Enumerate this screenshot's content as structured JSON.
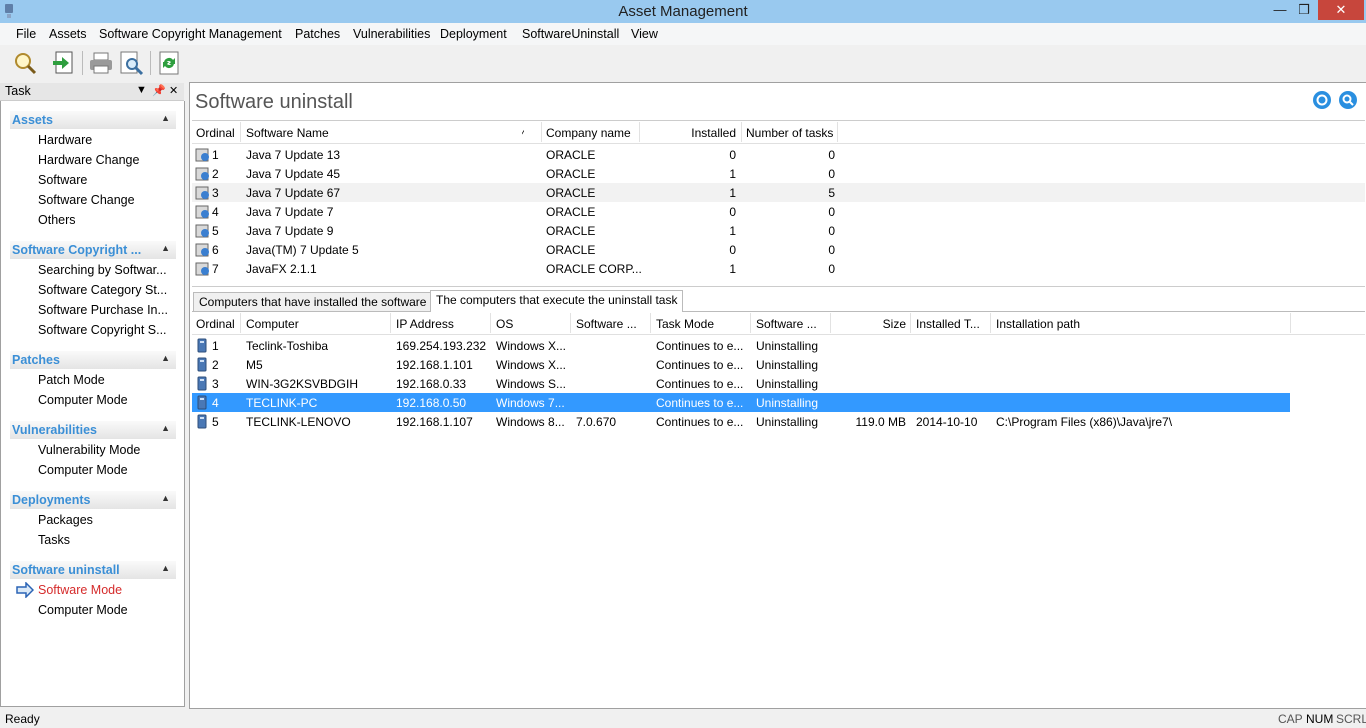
{
  "window": {
    "title": "Asset Management",
    "minimize": "—",
    "maximize": "❒",
    "close": "✕"
  },
  "menu": [
    "File",
    "Assets",
    "Software Copyright Management",
    "Patches",
    "Vulnerabilities",
    "Deployment",
    "SoftwareUninstall",
    "View"
  ],
  "toolbar": [
    "search-icon",
    "export-icon",
    "print-icon",
    "print-preview-icon",
    "refresh-icon"
  ],
  "task_panel": {
    "label": "Task",
    "groups": [
      {
        "title": "Assets",
        "items": [
          "Hardware",
          "Hardware Change",
          "Software",
          "Software Change",
          "Others"
        ]
      },
      {
        "title": "Software Copyright ...",
        "items": [
          "Searching by Softwar...",
          "Software Category St...",
          "Software Purchase In...",
          "Software Copyright S..."
        ]
      },
      {
        "title": "Patches",
        "items": [
          "Patch Mode",
          "Computer Mode"
        ]
      },
      {
        "title": "Vulnerabilities",
        "items": [
          "Vulnerability Mode",
          "Computer Mode"
        ]
      },
      {
        "title": "Deployments",
        "items": [
          "Packages",
          "Tasks"
        ]
      },
      {
        "title": "Software uninstall",
        "items": [
          "Software Mode",
          "Computer Mode"
        ]
      }
    ]
  },
  "main": {
    "heading": "Software uninstall",
    "software_table": {
      "columns": [
        "Ordinal",
        "Software Name",
        "Company name",
        "Installed",
        "Number of tasks"
      ],
      "rows": [
        [
          "1",
          "Java 7 Update 13",
          "ORACLE",
          "0",
          "0"
        ],
        [
          "2",
          "Java 7 Update 45",
          "ORACLE",
          "1",
          "0"
        ],
        [
          "3",
          "Java 7 Update 67",
          "ORACLE",
          "1",
          "5"
        ],
        [
          "4",
          "Java 7 Update 7",
          "ORACLE",
          "0",
          "0"
        ],
        [
          "5",
          "Java 7 Update 9",
          "ORACLE",
          "1",
          "0"
        ],
        [
          "6",
          "Java(TM) 7 Update 5",
          "ORACLE",
          "0",
          "0"
        ],
        [
          "7",
          "JavaFX 2.1.1",
          "ORACLE CORP...",
          "1",
          "0"
        ]
      ]
    },
    "tabs": [
      "Computers that have installed the software",
      "The computers that execute the uninstall task"
    ],
    "computer_table": {
      "columns": [
        "Ordinal",
        "Computer",
        "IP Address",
        "OS",
        "Software ...",
        "Task Mode",
        "Software ...",
        "Size",
        "Installed T...",
        "Installation path"
      ],
      "rows": [
        [
          "1",
          "Teclink-Toshiba",
          "169.254.193.232",
          "Windows X...",
          "",
          "Continues to e...",
          "Uninstalling",
          "",
          "",
          ""
        ],
        [
          "2",
          "M5",
          "192.168.1.101",
          "Windows X...",
          "",
          "Continues to e...",
          "Uninstalling",
          "",
          "",
          ""
        ],
        [
          "3",
          "WIN-3G2KSVBDGIH",
          "192.168.0.33",
          "Windows S...",
          "",
          "Continues to e...",
          "Uninstalling",
          "",
          "",
          ""
        ],
        [
          "4",
          "TECLINK-PC",
          "192.168.0.50",
          "Windows 7...",
          "",
          "Continues to e...",
          "Uninstalling",
          "",
          "",
          ""
        ],
        [
          "5",
          "TECLINK-LENOVO",
          "192.168.1.107",
          "Windows 8...",
          "7.0.670",
          "Continues to e...",
          "Uninstalling",
          "119.0 MB",
          "2014-10-10",
          "C:\\Program Files (x86)\\Java\\jre7\\"
        ]
      ]
    }
  },
  "status": {
    "left": "Ready",
    "cap": "CAP",
    "num": "NUM",
    "scrl": "SCRL"
  }
}
